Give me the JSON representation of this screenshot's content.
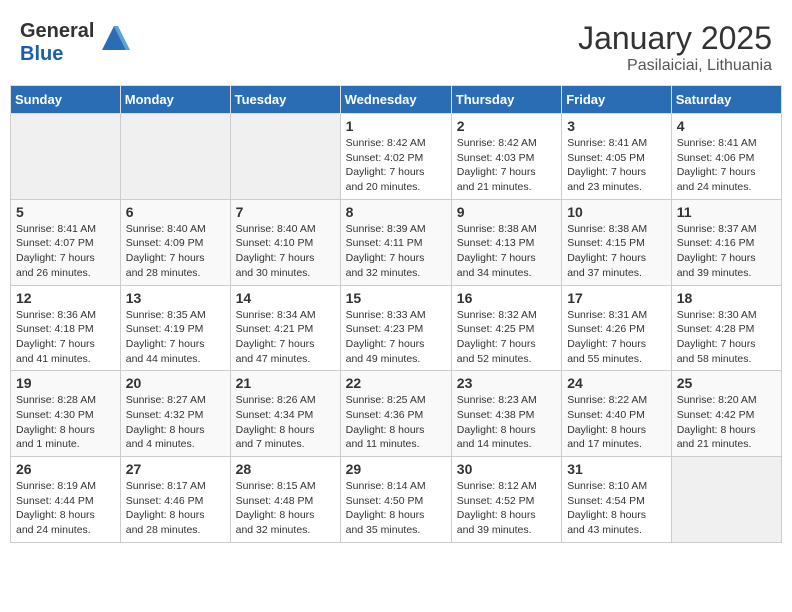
{
  "header": {
    "logo_general": "General",
    "logo_blue": "Blue",
    "month_year": "January 2025",
    "location": "Pasilaiciai, Lithuania"
  },
  "weekdays": [
    "Sunday",
    "Monday",
    "Tuesday",
    "Wednesday",
    "Thursday",
    "Friday",
    "Saturday"
  ],
  "weeks": [
    [
      {
        "day": "",
        "info": ""
      },
      {
        "day": "",
        "info": ""
      },
      {
        "day": "",
        "info": ""
      },
      {
        "day": "1",
        "info": "Sunrise: 8:42 AM\nSunset: 4:02 PM\nDaylight: 7 hours\nand 20 minutes."
      },
      {
        "day": "2",
        "info": "Sunrise: 8:42 AM\nSunset: 4:03 PM\nDaylight: 7 hours\nand 21 minutes."
      },
      {
        "day": "3",
        "info": "Sunrise: 8:41 AM\nSunset: 4:05 PM\nDaylight: 7 hours\nand 23 minutes."
      },
      {
        "day": "4",
        "info": "Sunrise: 8:41 AM\nSunset: 4:06 PM\nDaylight: 7 hours\nand 24 minutes."
      }
    ],
    [
      {
        "day": "5",
        "info": "Sunrise: 8:41 AM\nSunset: 4:07 PM\nDaylight: 7 hours\nand 26 minutes."
      },
      {
        "day": "6",
        "info": "Sunrise: 8:40 AM\nSunset: 4:09 PM\nDaylight: 7 hours\nand 28 minutes."
      },
      {
        "day": "7",
        "info": "Sunrise: 8:40 AM\nSunset: 4:10 PM\nDaylight: 7 hours\nand 30 minutes."
      },
      {
        "day": "8",
        "info": "Sunrise: 8:39 AM\nSunset: 4:11 PM\nDaylight: 7 hours\nand 32 minutes."
      },
      {
        "day": "9",
        "info": "Sunrise: 8:38 AM\nSunset: 4:13 PM\nDaylight: 7 hours\nand 34 minutes."
      },
      {
        "day": "10",
        "info": "Sunrise: 8:38 AM\nSunset: 4:15 PM\nDaylight: 7 hours\nand 37 minutes."
      },
      {
        "day": "11",
        "info": "Sunrise: 8:37 AM\nSunset: 4:16 PM\nDaylight: 7 hours\nand 39 minutes."
      }
    ],
    [
      {
        "day": "12",
        "info": "Sunrise: 8:36 AM\nSunset: 4:18 PM\nDaylight: 7 hours\nand 41 minutes."
      },
      {
        "day": "13",
        "info": "Sunrise: 8:35 AM\nSunset: 4:19 PM\nDaylight: 7 hours\nand 44 minutes."
      },
      {
        "day": "14",
        "info": "Sunrise: 8:34 AM\nSunset: 4:21 PM\nDaylight: 7 hours\nand 47 minutes."
      },
      {
        "day": "15",
        "info": "Sunrise: 8:33 AM\nSunset: 4:23 PM\nDaylight: 7 hours\nand 49 minutes."
      },
      {
        "day": "16",
        "info": "Sunrise: 8:32 AM\nSunset: 4:25 PM\nDaylight: 7 hours\nand 52 minutes."
      },
      {
        "day": "17",
        "info": "Sunrise: 8:31 AM\nSunset: 4:26 PM\nDaylight: 7 hours\nand 55 minutes."
      },
      {
        "day": "18",
        "info": "Sunrise: 8:30 AM\nSunset: 4:28 PM\nDaylight: 7 hours\nand 58 minutes."
      }
    ],
    [
      {
        "day": "19",
        "info": "Sunrise: 8:28 AM\nSunset: 4:30 PM\nDaylight: 8 hours\nand 1 minute."
      },
      {
        "day": "20",
        "info": "Sunrise: 8:27 AM\nSunset: 4:32 PM\nDaylight: 8 hours\nand 4 minutes."
      },
      {
        "day": "21",
        "info": "Sunrise: 8:26 AM\nSunset: 4:34 PM\nDaylight: 8 hours\nand 7 minutes."
      },
      {
        "day": "22",
        "info": "Sunrise: 8:25 AM\nSunset: 4:36 PM\nDaylight: 8 hours\nand 11 minutes."
      },
      {
        "day": "23",
        "info": "Sunrise: 8:23 AM\nSunset: 4:38 PM\nDaylight: 8 hours\nand 14 minutes."
      },
      {
        "day": "24",
        "info": "Sunrise: 8:22 AM\nSunset: 4:40 PM\nDaylight: 8 hours\nand 17 minutes."
      },
      {
        "day": "25",
        "info": "Sunrise: 8:20 AM\nSunset: 4:42 PM\nDaylight: 8 hours\nand 21 minutes."
      }
    ],
    [
      {
        "day": "26",
        "info": "Sunrise: 8:19 AM\nSunset: 4:44 PM\nDaylight: 8 hours\nand 24 minutes."
      },
      {
        "day": "27",
        "info": "Sunrise: 8:17 AM\nSunset: 4:46 PM\nDaylight: 8 hours\nand 28 minutes."
      },
      {
        "day": "28",
        "info": "Sunrise: 8:15 AM\nSunset: 4:48 PM\nDaylight: 8 hours\nand 32 minutes."
      },
      {
        "day": "29",
        "info": "Sunrise: 8:14 AM\nSunset: 4:50 PM\nDaylight: 8 hours\nand 35 minutes."
      },
      {
        "day": "30",
        "info": "Sunrise: 8:12 AM\nSunset: 4:52 PM\nDaylight: 8 hours\nand 39 minutes."
      },
      {
        "day": "31",
        "info": "Sunrise: 8:10 AM\nSunset: 4:54 PM\nDaylight: 8 hours\nand 43 minutes."
      },
      {
        "day": "",
        "info": ""
      }
    ]
  ]
}
